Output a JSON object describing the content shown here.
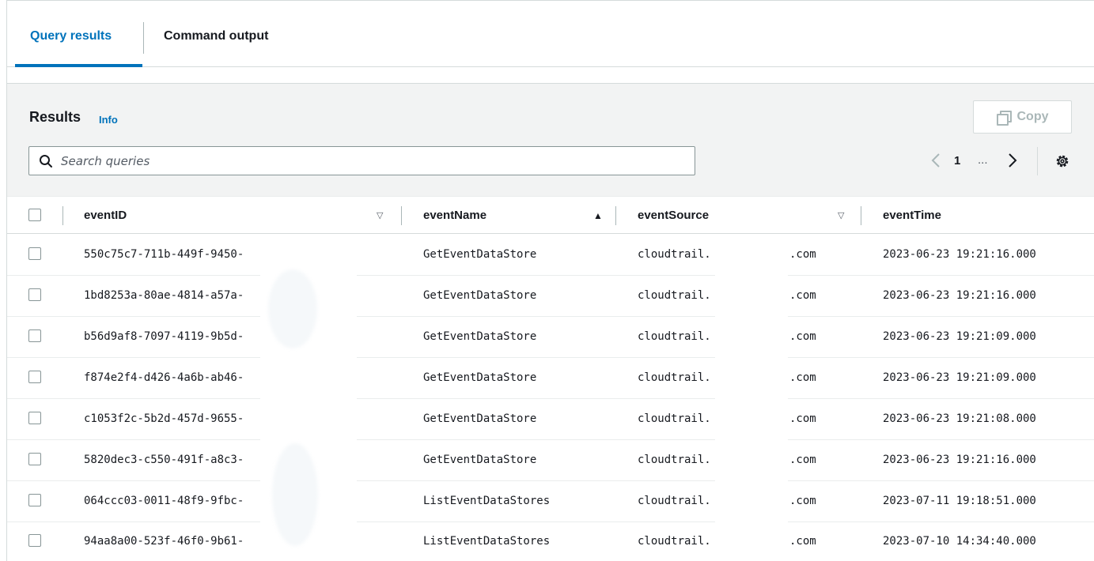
{
  "tabs": [
    {
      "label": "Query results",
      "active": true
    },
    {
      "label": "Command output",
      "active": false
    }
  ],
  "results": {
    "title": "Results",
    "info_label": "Info",
    "copy_label": "Copy",
    "search_placeholder": "Search queries"
  },
  "pagination": {
    "current_page": "1",
    "ellipsis": "...",
    "prev_icon": "chevron-left-icon",
    "next_icon": "chevron-right-icon"
  },
  "table": {
    "columns": [
      {
        "label": "eventID",
        "sort": "sortable"
      },
      {
        "label": "eventName",
        "sort": "ascending"
      },
      {
        "label": "eventSource",
        "sort": "sortable"
      },
      {
        "label": "eventTime",
        "sort": "none"
      }
    ],
    "rows": [
      {
        "eventID": "550c75c7-711b-449f-9450-",
        "eventName": "GetEventDataStore",
        "eventSourcePrefix": "cloudtrail.",
        "eventSourceSuffix": ".com",
        "eventTime": "2023-06-23 19:21:16.000"
      },
      {
        "eventID": "1bd8253a-80ae-4814-a57a-",
        "eventName": "GetEventDataStore",
        "eventSourcePrefix": "cloudtrail.",
        "eventSourceSuffix": ".com",
        "eventTime": "2023-06-23 19:21:16.000"
      },
      {
        "eventID": "b56d9af8-7097-4119-9b5d-",
        "eventName": "GetEventDataStore",
        "eventSourcePrefix": "cloudtrail.",
        "eventSourceSuffix": ".com",
        "eventTime": "2023-06-23 19:21:09.000"
      },
      {
        "eventID": "f874e2f4-d426-4a6b-ab46-",
        "eventName": "GetEventDataStore",
        "eventSourcePrefix": "cloudtrail.",
        "eventSourceSuffix": ".com",
        "eventTime": "2023-06-23 19:21:09.000"
      },
      {
        "eventID": "c1053f2c-5b2d-457d-9655-",
        "eventName": "GetEventDataStore",
        "eventSourcePrefix": "cloudtrail.",
        "eventSourceSuffix": ".com",
        "eventTime": "2023-06-23 19:21:08.000"
      },
      {
        "eventID": "5820dec3-c550-491f-a8c3-",
        "eventName": "GetEventDataStore",
        "eventSourcePrefix": "cloudtrail.",
        "eventSourceSuffix": ".com",
        "eventTime": "2023-06-23 19:21:16.000"
      },
      {
        "eventID": "064ccc03-0011-48f9-9fbc-",
        "eventName": "ListEventDataStores",
        "eventSourcePrefix": "cloudtrail.",
        "eventSourceSuffix": ".com",
        "eventTime": "2023-07-11 19:18:51.000"
      },
      {
        "eventID": "94aa8a00-523f-46f0-9b61-",
        "eventName": "ListEventDataStores",
        "eventSourcePrefix": "cloudtrail.",
        "eventSourceSuffix": ".com",
        "eventTime": "2023-07-10 14:34:40.000"
      }
    ]
  },
  "colors": {
    "accent": "#0073bb",
    "text": "#16191f",
    "muted": "#aab7b8",
    "panel_bg": "#f2f3f3"
  }
}
